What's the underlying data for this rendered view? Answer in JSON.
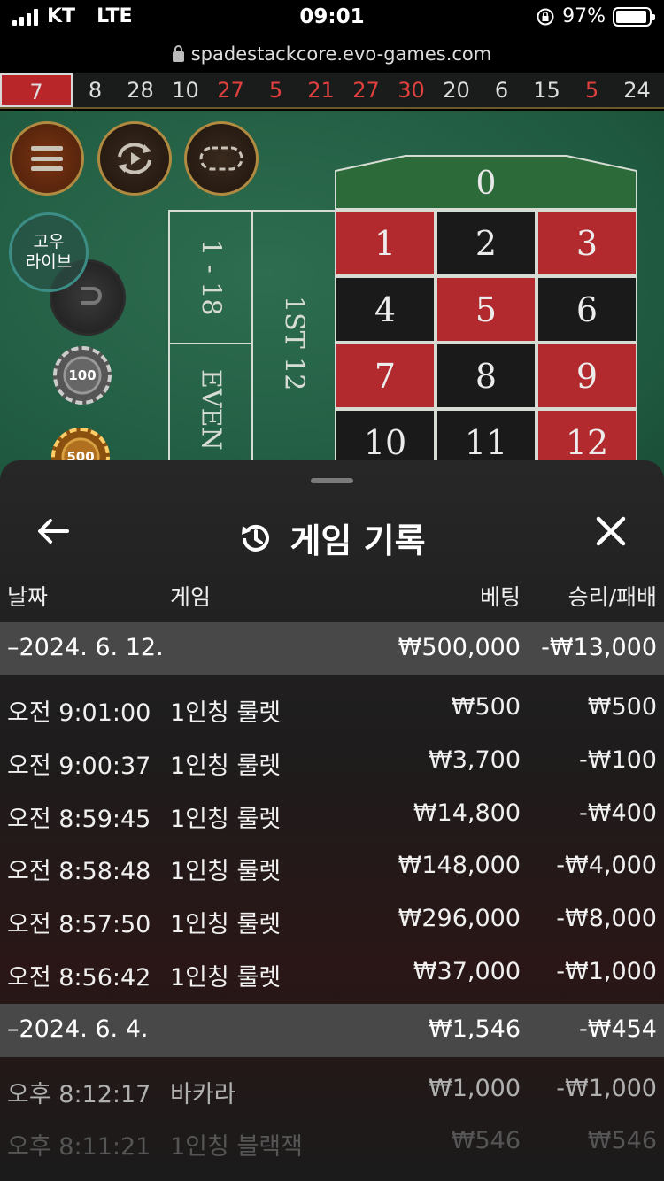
{
  "status": {
    "carrier": "KT",
    "network": "LTE",
    "time": "09:01",
    "battery": "97%"
  },
  "browser": {
    "url": "spadestackcore.evo-games.com"
  },
  "history": [
    {
      "n": "7",
      "c": "red"
    },
    {
      "n": "8",
      "c": "black"
    },
    {
      "n": "28",
      "c": "black"
    },
    {
      "n": "10",
      "c": "black"
    },
    {
      "n": "27",
      "c": "red"
    },
    {
      "n": "5",
      "c": "red"
    },
    {
      "n": "21",
      "c": "red"
    },
    {
      "n": "27",
      "c": "red"
    },
    {
      "n": "30",
      "c": "red"
    },
    {
      "n": "20",
      "c": "black"
    },
    {
      "n": "6",
      "c": "black"
    },
    {
      "n": "15",
      "c": "black"
    },
    {
      "n": "5",
      "c": "red"
    },
    {
      "n": "24",
      "c": "black"
    }
  ],
  "table": {
    "live_badge": [
      "고우",
      "라이브"
    ],
    "chips": [
      "100",
      "500"
    ],
    "bets": {
      "low": "1 - 18",
      "dozen": "1ST 12",
      "even": "EVEN"
    },
    "zero": "0",
    "numbers": [
      {
        "n": "1",
        "c": "red"
      },
      {
        "n": "2",
        "c": "black"
      },
      {
        "n": "3",
        "c": "red"
      },
      {
        "n": "4",
        "c": "black"
      },
      {
        "n": "5",
        "c": "red"
      },
      {
        "n": "6",
        "c": "black"
      },
      {
        "n": "7",
        "c": "red"
      },
      {
        "n": "8",
        "c": "black"
      },
      {
        "n": "9",
        "c": "red"
      },
      {
        "n": "10",
        "c": "black"
      },
      {
        "n": "11",
        "c": "black"
      },
      {
        "n": "12",
        "c": "red"
      }
    ]
  },
  "sheet": {
    "title": "게임 기록",
    "columns": {
      "date": "날짜",
      "game": "게임",
      "bet": "베팅",
      "result": "승리/패배"
    },
    "groups": [
      {
        "date": "–2024. 6. 12.",
        "bet": "₩500,000",
        "result": "-₩13,000",
        "rows": [
          {
            "time": "오전 9:01:00",
            "game": "1인칭 룰렛",
            "bet": "₩500",
            "result": "₩500"
          },
          {
            "time": "오전 9:00:37",
            "game": "1인칭 룰렛",
            "bet": "₩3,700",
            "result": "-₩100"
          },
          {
            "time": "오전 8:59:45",
            "game": "1인칭 룰렛",
            "bet": "₩14,800",
            "result": "-₩400"
          },
          {
            "time": "오전 8:58:48",
            "game": "1인칭 룰렛",
            "bet": "₩148,000",
            "result": "-₩4,000"
          },
          {
            "time": "오전 8:57:50",
            "game": "1인칭 룰렛",
            "bet": "₩296,000",
            "result": "-₩8,000"
          },
          {
            "time": "오전 8:56:42",
            "game": "1인칭 룰렛",
            "bet": "₩37,000",
            "result": "-₩1,000"
          }
        ]
      },
      {
        "date": "–2024. 6. 4.",
        "bet": "₩1,546",
        "result": "-₩454",
        "rows": [
          {
            "time": "오후 8:12:17",
            "game": "바카라",
            "bet": "₩1,000",
            "result": "-₩1,000"
          },
          {
            "time": "오후 8:11:21",
            "game": "1인칭 블랙잭",
            "bet": "₩546",
            "result": "₩546"
          }
        ]
      }
    ]
  }
}
